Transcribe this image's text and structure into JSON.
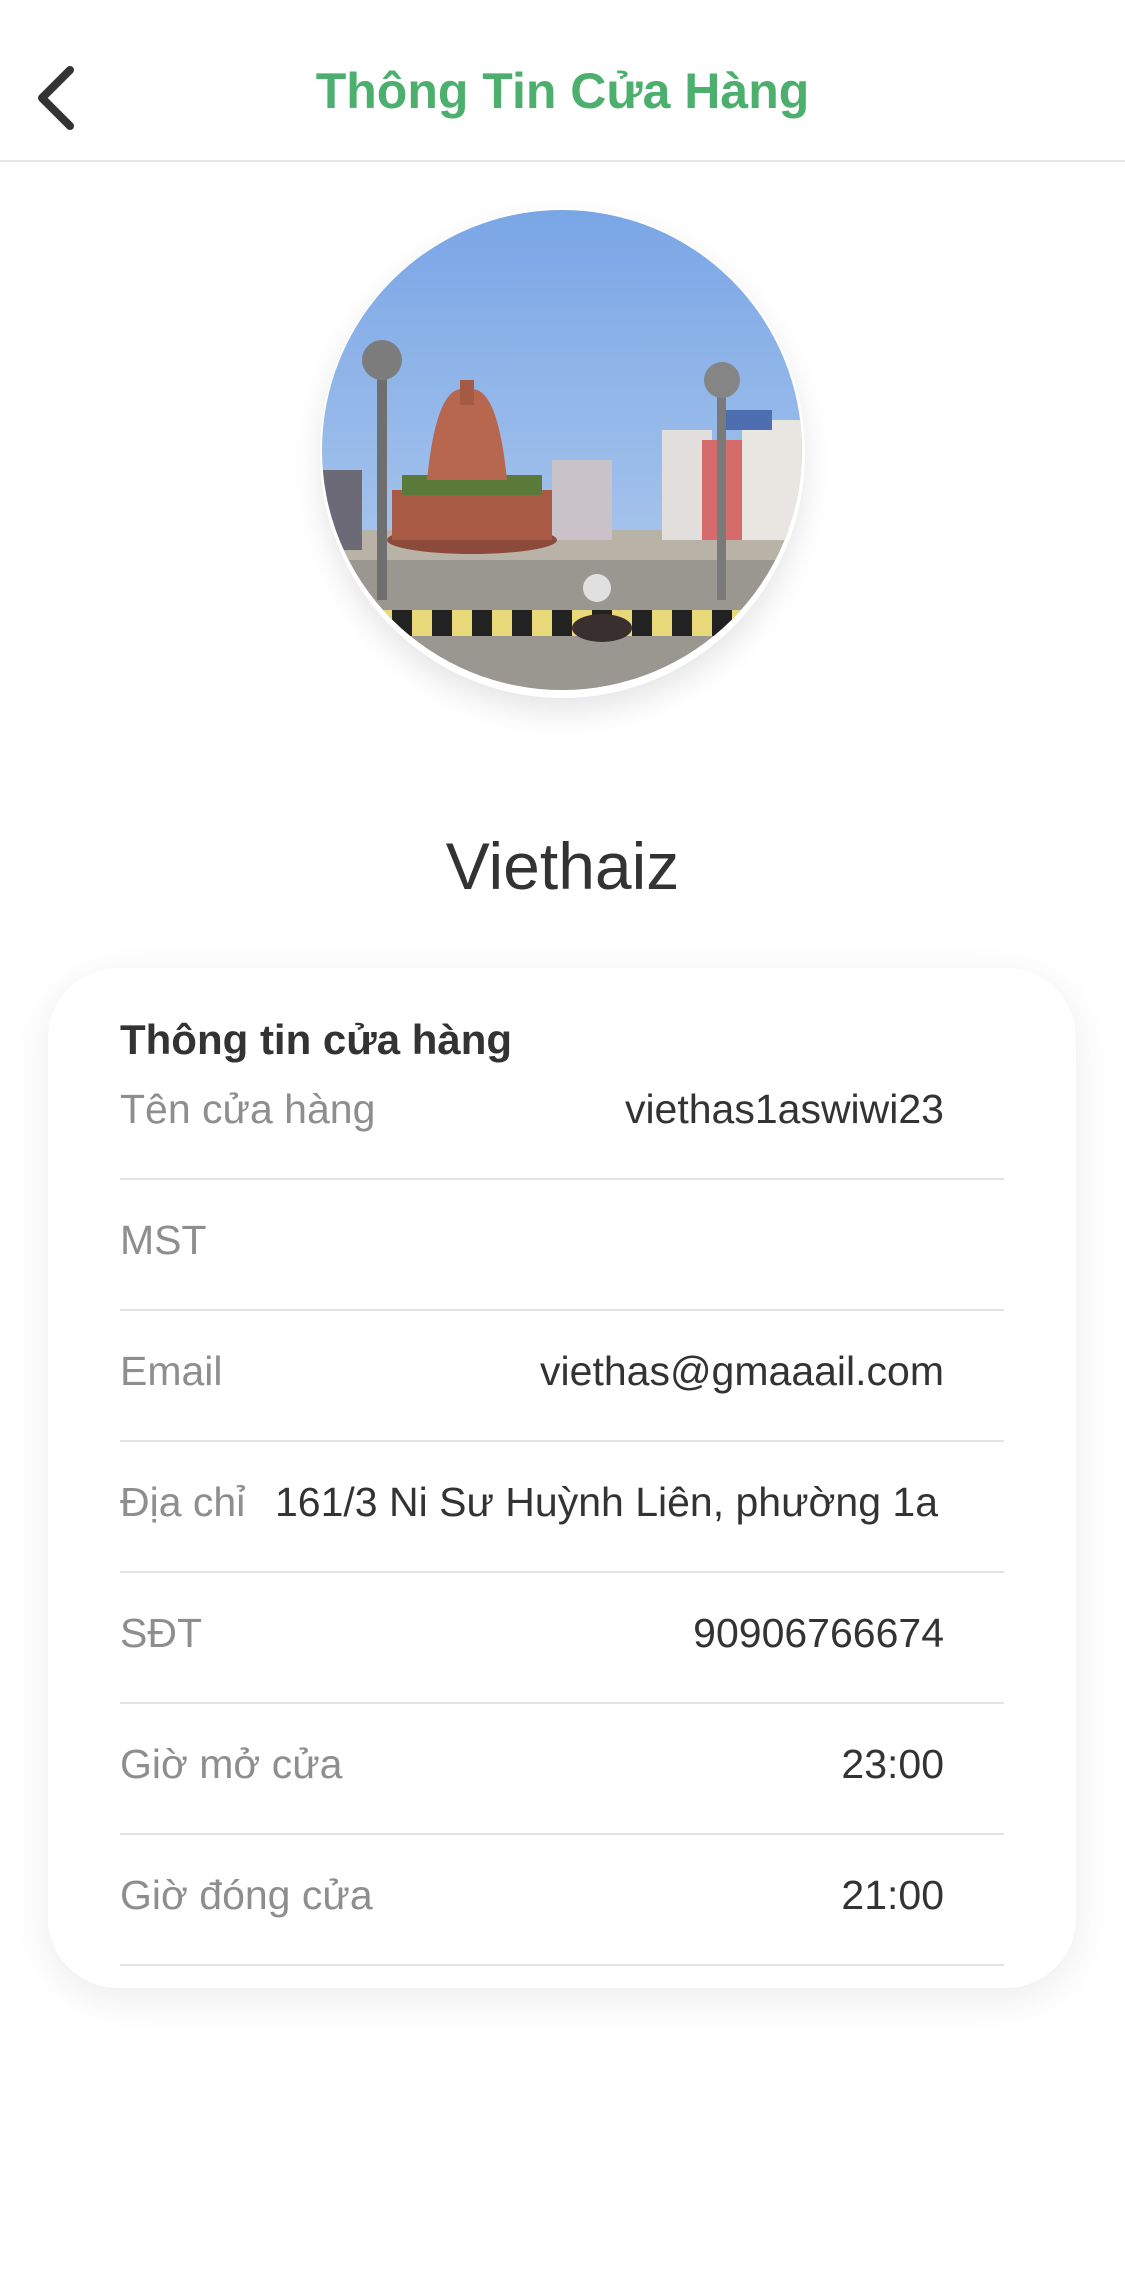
{
  "header": {
    "title": "Thông Tin Cửa Hàng",
    "back_icon": "chevron-left-icon",
    "title_color": "#4caf6e"
  },
  "store": {
    "display_name": "Viethaiz",
    "avatar": "store-photo"
  },
  "info": {
    "section_title": "Thông tin cửa hàng",
    "rows": [
      {
        "label": "Tên cửa hàng",
        "value": "viethas1aswiwi23"
      },
      {
        "label": "MST",
        "value": ""
      },
      {
        "label": "Email",
        "value": "viethas@gmaaail.com"
      },
      {
        "label": "Địa chỉ",
        "value": "161/3 Ni Sư Huỳnh Liên, phường 1a"
      },
      {
        "label": "SĐT",
        "value": "90906766674"
      },
      {
        "label": "Giờ mở cửa",
        "value": "23:00"
      },
      {
        "label": "Giờ đóng cửa",
        "value": "21:00"
      }
    ]
  }
}
